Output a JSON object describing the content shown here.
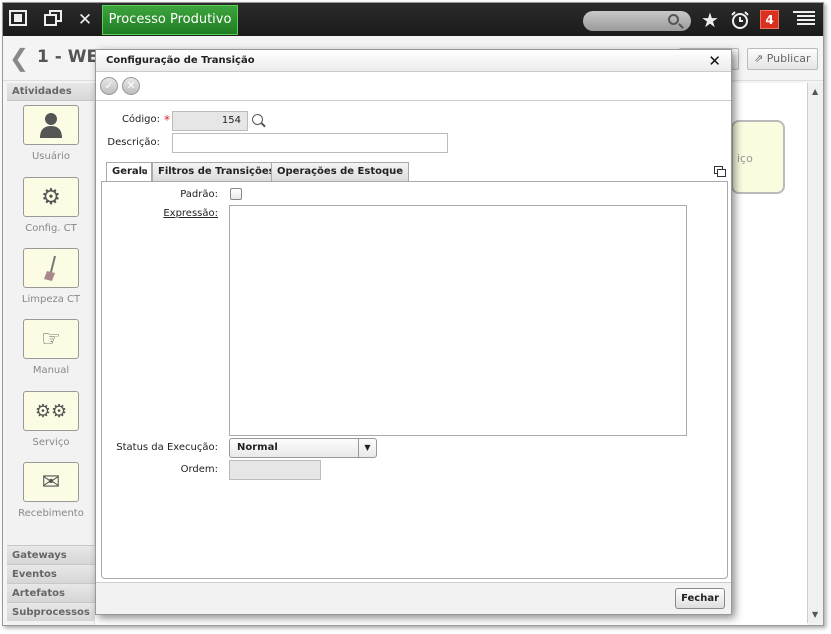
{
  "topbar": {
    "active_tab": "Processo Produtivo",
    "notification_count": "4",
    "icons": [
      "fullscreen-icon",
      "restore-icon",
      "close-icon",
      "search-icon",
      "star-icon",
      "alarm-icon",
      "menu-icon"
    ]
  },
  "header": {
    "process_title": "1 - WES",
    "publish_label": "Publicar"
  },
  "palette": {
    "section_title": "Atividades",
    "items": [
      {
        "label": "Usuário",
        "icon": "user-icon"
      },
      {
        "label": "Config. CT",
        "icon": "gear-icon"
      },
      {
        "label": "Limpeza CT",
        "icon": "broom-icon"
      },
      {
        "label": "Manual",
        "icon": "hand-icon"
      },
      {
        "label": "Serviço",
        "icon": "gears-icon"
      },
      {
        "label": "Recebimento",
        "icon": "envelope-icon"
      }
    ],
    "bottom_sections": [
      "Gateways",
      "Eventos",
      "Artefatos",
      "Subprocessos"
    ]
  },
  "canvas": {
    "node_text": "iço"
  },
  "modal": {
    "title": "Configuração de Transição",
    "codigo_label": "Código:",
    "codigo_value": "154",
    "descricao_label": "Descrição:",
    "descricao_value": "",
    "tabs": [
      "Geral",
      "Filtros de Transições",
      "Operações de Estoque"
    ],
    "padrao_label": "Padrão:",
    "expressao_label": "Expressão:",
    "status_label": "Status da Execução:",
    "status_value": "Normal",
    "ordem_label": "Ordem:",
    "ordem_value": "",
    "close_button": "Fechar"
  }
}
